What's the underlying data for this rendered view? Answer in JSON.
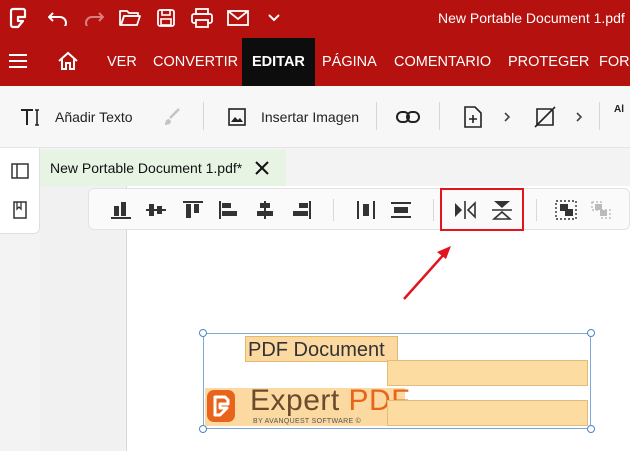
{
  "titlebar": {
    "document_title": "New Portable Document 1.pdf"
  },
  "quick_access": [
    "app-logo-icon",
    "undo-icon",
    "redo-icon",
    "open-folder-icon",
    "save-icon",
    "print-icon",
    "email-icon",
    "chevron-down-icon"
  ],
  "ribbon": {
    "tabs": [
      {
        "label": "VER"
      },
      {
        "label": "CONVERTIR"
      },
      {
        "label": "EDITAR"
      },
      {
        "label": "PÁGINA"
      },
      {
        "label": "COMENTARIO"
      },
      {
        "label": "PROTEGER"
      },
      {
        "label": "FORM"
      }
    ],
    "active_tab": "EDITAR"
  },
  "toolbar": {
    "add_text_label": "Añadir Texto",
    "insert_image_label": "Insertar Imagen",
    "more_label": "Al"
  },
  "document_tab": {
    "label": "New Portable Document 1.pdf*"
  },
  "canvas": {
    "pdf_document_text": "PDF Document",
    "logo_word": "Expert ",
    "logo_pdf": "PDF",
    "logo_tagline": "BY AVANQUEST SOFTWARE ©"
  },
  "colors": {
    "brand_red": "#b5110e",
    "active_tab_bg": "#0d0d0d",
    "highlight": "#e3141b",
    "field_fill": "#fcdca1",
    "logo_orange": "#e8641b"
  }
}
